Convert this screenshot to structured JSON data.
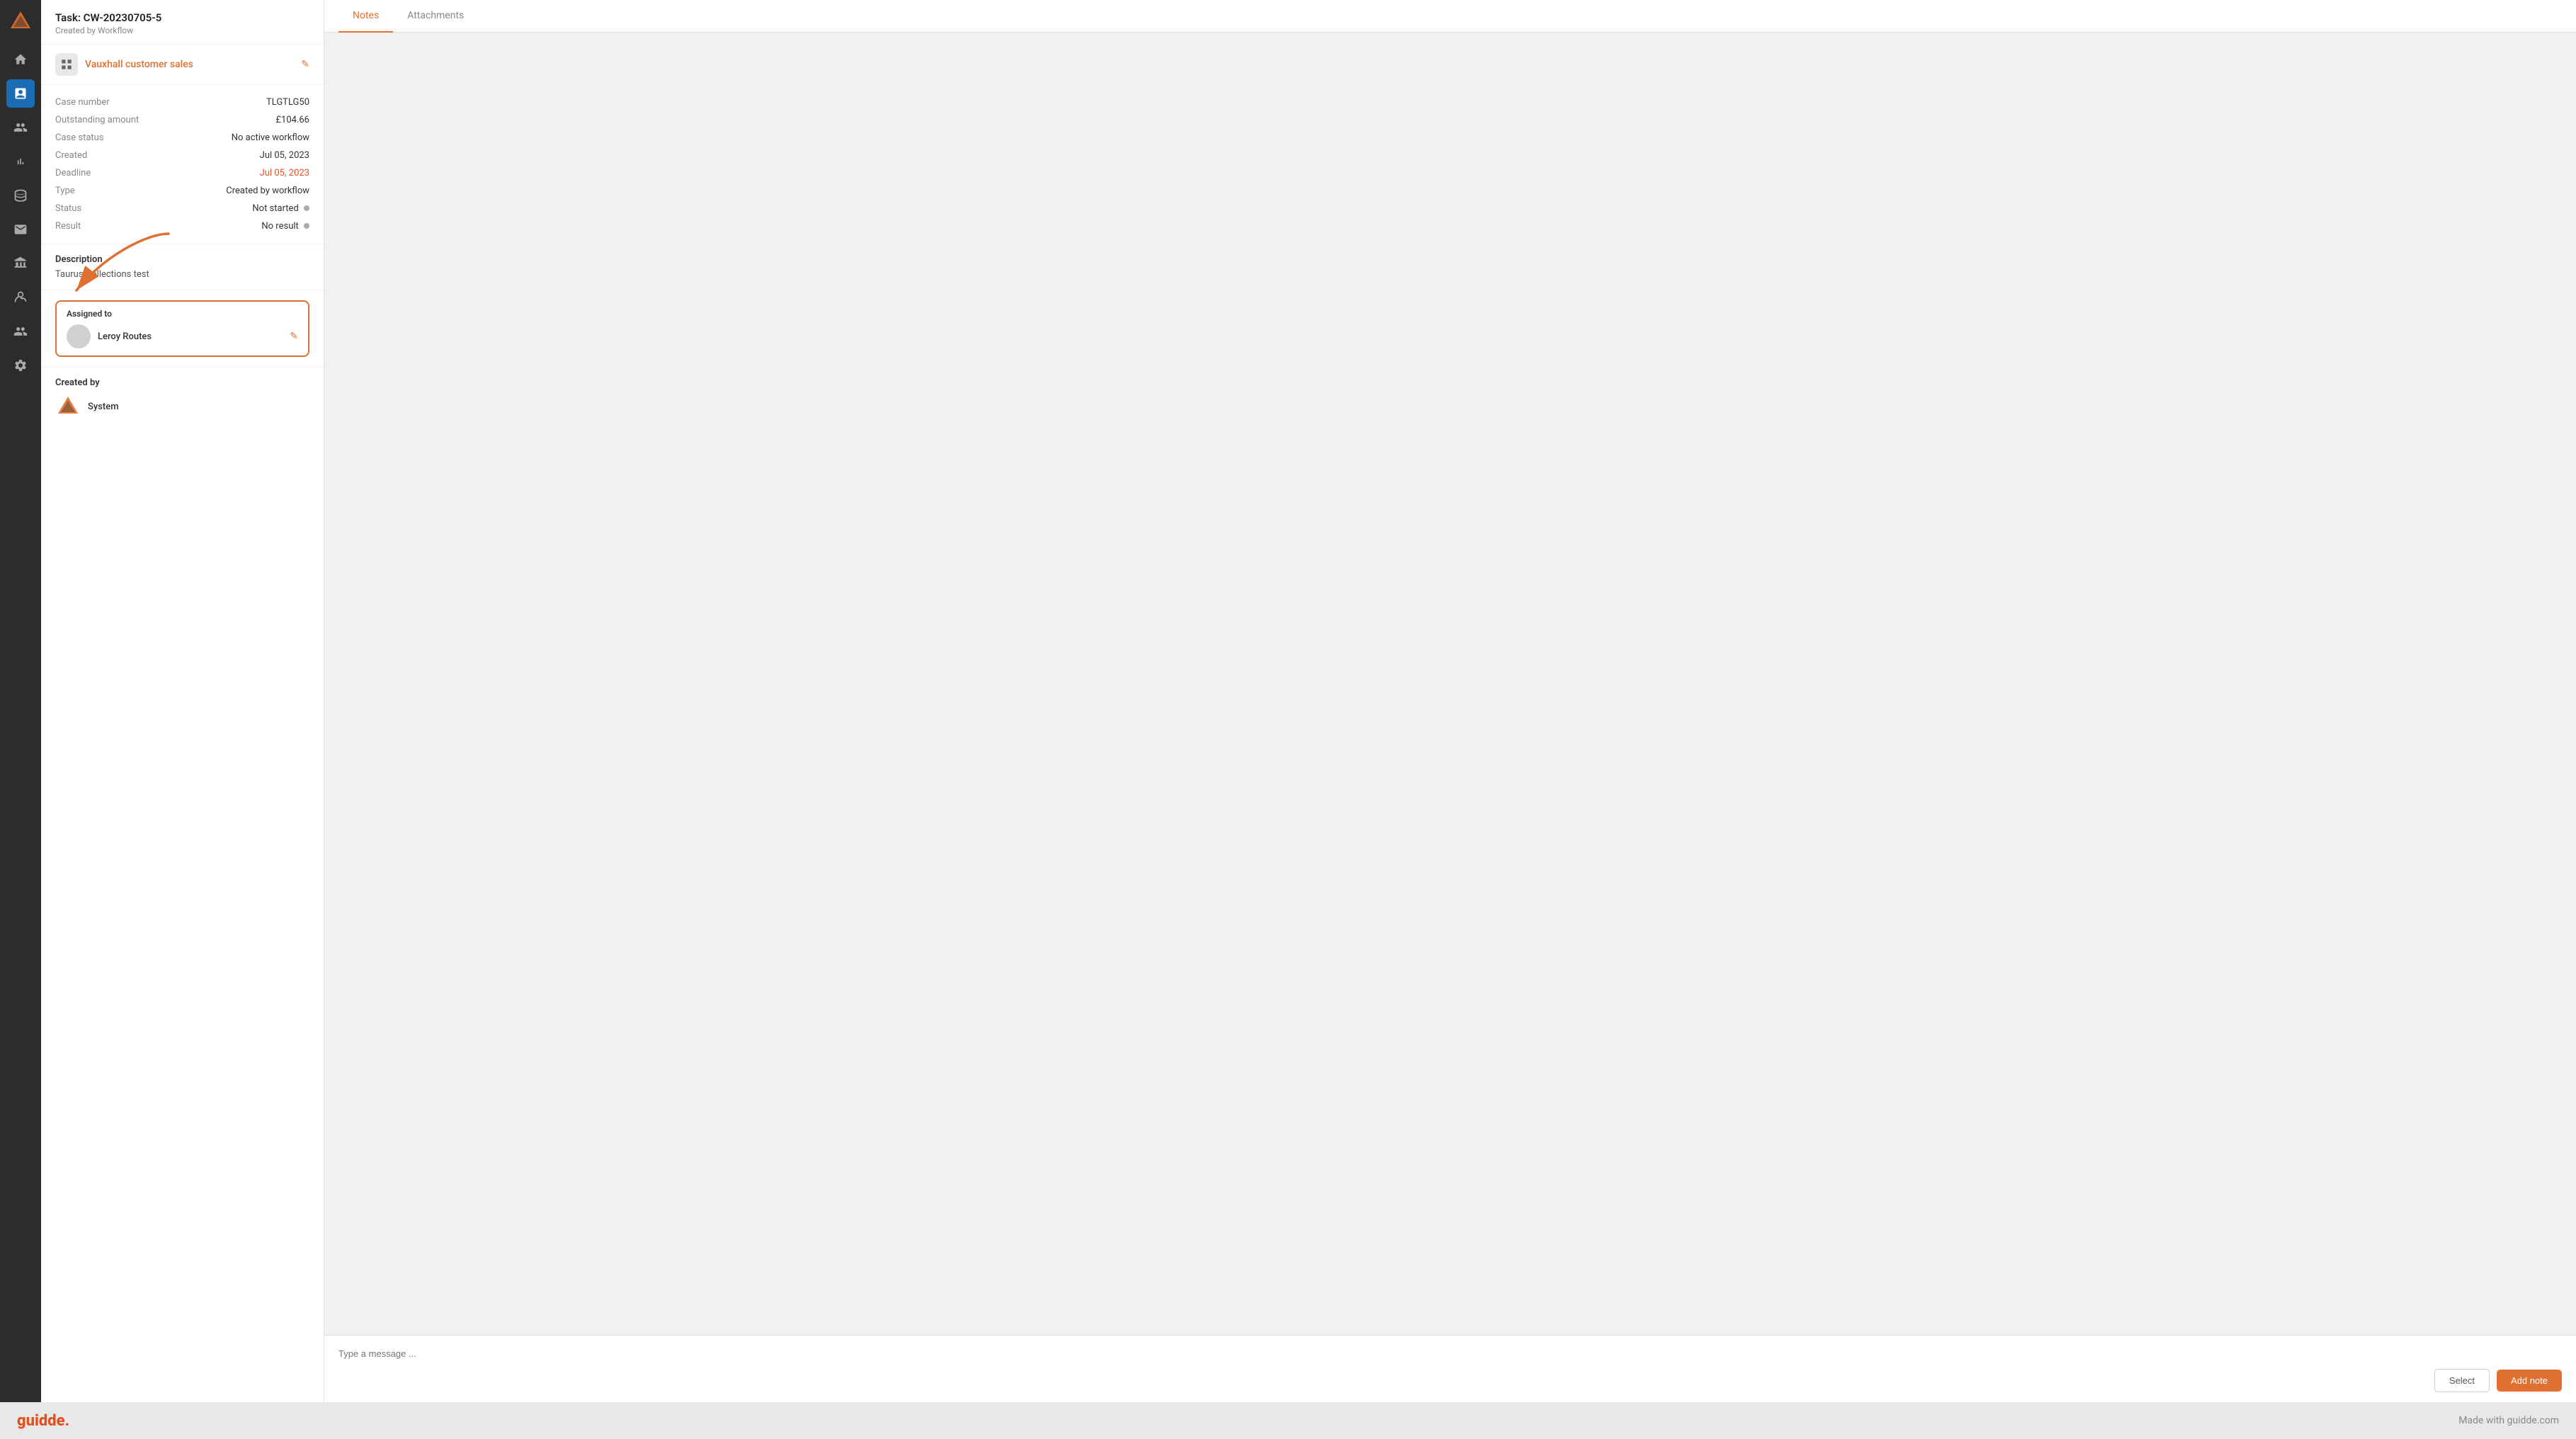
{
  "sidebar": {
    "logo": "◆",
    "items": [
      {
        "id": "home",
        "icon": "home",
        "active": false
      },
      {
        "id": "tasks",
        "icon": "tasks",
        "active": true
      },
      {
        "id": "contacts",
        "icon": "contacts",
        "active": false
      },
      {
        "id": "reports",
        "icon": "reports",
        "active": false
      },
      {
        "id": "database",
        "icon": "database",
        "active": false
      },
      {
        "id": "mail",
        "icon": "mail",
        "active": false
      },
      {
        "id": "bank",
        "icon": "bank",
        "active": false
      },
      {
        "id": "integrations",
        "icon": "integrations",
        "active": false
      },
      {
        "id": "team",
        "icon": "team",
        "active": false
      },
      {
        "id": "settings",
        "icon": "settings",
        "active": false
      }
    ]
  },
  "task": {
    "title": "Task: CW-20230705-5",
    "subtitle": "Created by Workflow",
    "company": {
      "name": "Vauxhall customer sales",
      "icon": "grid"
    },
    "fields": [
      {
        "label": "Case number",
        "value": "TLGTLG50",
        "style": "normal"
      },
      {
        "label": "Outstanding amount",
        "value": "£104.66",
        "style": "normal"
      },
      {
        "label": "Case status",
        "value": "No active workflow",
        "style": "normal"
      },
      {
        "label": "Created",
        "value": "Jul 05, 2023",
        "style": "normal"
      },
      {
        "label": "Deadline",
        "value": "Jul 05, 2023",
        "style": "red"
      },
      {
        "label": "Type",
        "value": "Created by workflow",
        "style": "normal"
      },
      {
        "label": "Status",
        "value": "Not started",
        "style": "dot"
      },
      {
        "label": "Result",
        "value": "No result",
        "style": "dot"
      }
    ],
    "description": {
      "title": "Description",
      "text": "Taurus Collections test"
    },
    "assigned_to": {
      "title": "Assigned to",
      "assignee": {
        "name": "Leroy Routes"
      }
    },
    "created_by": {
      "title": "Created by",
      "creator": "System"
    }
  },
  "tabs": {
    "notes_label": "Notes",
    "attachments_label": "Attachments",
    "active": "notes"
  },
  "message_input": {
    "placeholder": "Type a message ..."
  },
  "buttons": {
    "select_label": "Select",
    "add_note_label": "Add note"
  },
  "footer": {
    "brand": "guidde.",
    "tagline": "Made with guidde.com"
  }
}
